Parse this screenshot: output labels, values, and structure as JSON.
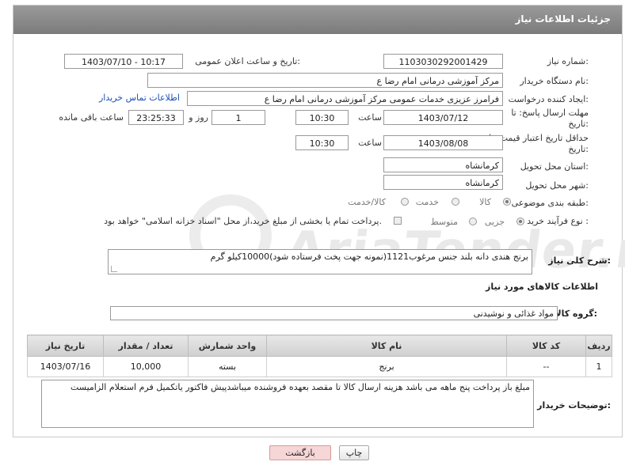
{
  "header": {
    "title": "جزئیات اطلاعات نیاز"
  },
  "fields": {
    "need_number_label": "شماره نیاز:",
    "need_number": "1103030292001429",
    "announce_label": "تاریخ و ساعت اعلان عمومی:",
    "announce_value": "1403/07/10 - 10:17",
    "buyer_org_label": "نام دستگاه خریدار:",
    "buyer_org": "مرکز آموزشی  درمانی امام رضا  ع",
    "requester_label": "ایجاد کننده درخواست:",
    "requester": "فرامرز عزیزی خدمات عمومی مرکز آموزشی  درمانی امام رضا  ع",
    "contact_link": "اطلاعات تماس خریدار",
    "deadline_label_1": "مهلت ارسال پاسخ: تا",
    "deadline_label_2": "تاریخ:",
    "deadline_date": "1403/07/12",
    "time_label": "ساعت",
    "deadline_time": "10:30",
    "days_value": "1",
    "days_label": "روز و",
    "remaining_time": "23:25:33",
    "remaining_label": "ساعت باقی مانده",
    "validity_label_1": "حداقل تاریخ اعتبار قیمت: تا",
    "validity_label_2": "تاریخ:",
    "validity_date": "1403/08/08",
    "validity_time_label": "ساعت",
    "validity_time": "10:30",
    "province_label": "استان محل تحویل:",
    "province": "کرمانشاه",
    "city_label": "شهر محل تحویل:",
    "city": "کرمانشاه",
    "category_label": "طبقه بندی موضوعی:",
    "category_options": [
      "کالا",
      "خدمت",
      "کالا/خدمت"
    ],
    "purchase_label": "نوع فرآیند خرید :",
    "purchase_options": [
      "جزیی",
      "متوسط"
    ],
    "purchase_note": "پرداخت تمام یا بخشی از مبلغ خرید،از محل \"اسناد خزانه اسلامی\" خواهد بود."
  },
  "summary": {
    "label": "شرح کلی نیاز:",
    "text": "برنج هندی دانه بلند جنس مرغوب1121(نمونه جهت پخت فرستاده شود)10000کیلو گرم"
  },
  "goods_section": {
    "title": "اطلاعات کالاهای مورد نیاز",
    "group_label": "گروه کالا:",
    "group_value": "مواد غذائی و نوشیدنی"
  },
  "table": {
    "headers": [
      "ردیف",
      "کد کالا",
      "نام کالا",
      "واحد شمارش",
      "تعداد / مقدار",
      "تاریخ نیاز"
    ],
    "rows": [
      [
        "1",
        "--",
        "برنج",
        "بسته",
        "10,000",
        "1403/07/16"
      ]
    ]
  },
  "buyer_notes": {
    "label": "توضیحات خریدار:",
    "text": "مبلغ باز پرداخت پنج ماهه می باشد هزینه ارسال کالا تا مقصد بعهده فروشنده میباشدپیش فاکتور یاتکمیل فرم استعلام الزامیست"
  },
  "buttons": {
    "print": "چاپ",
    "back": "بازگشت"
  },
  "watermark": "AriaTender.net",
  "colors": {
    "header_bg": "#8a8a8a",
    "link": "#1b4fb8",
    "back_btn_bg": "#f6d6d6"
  }
}
